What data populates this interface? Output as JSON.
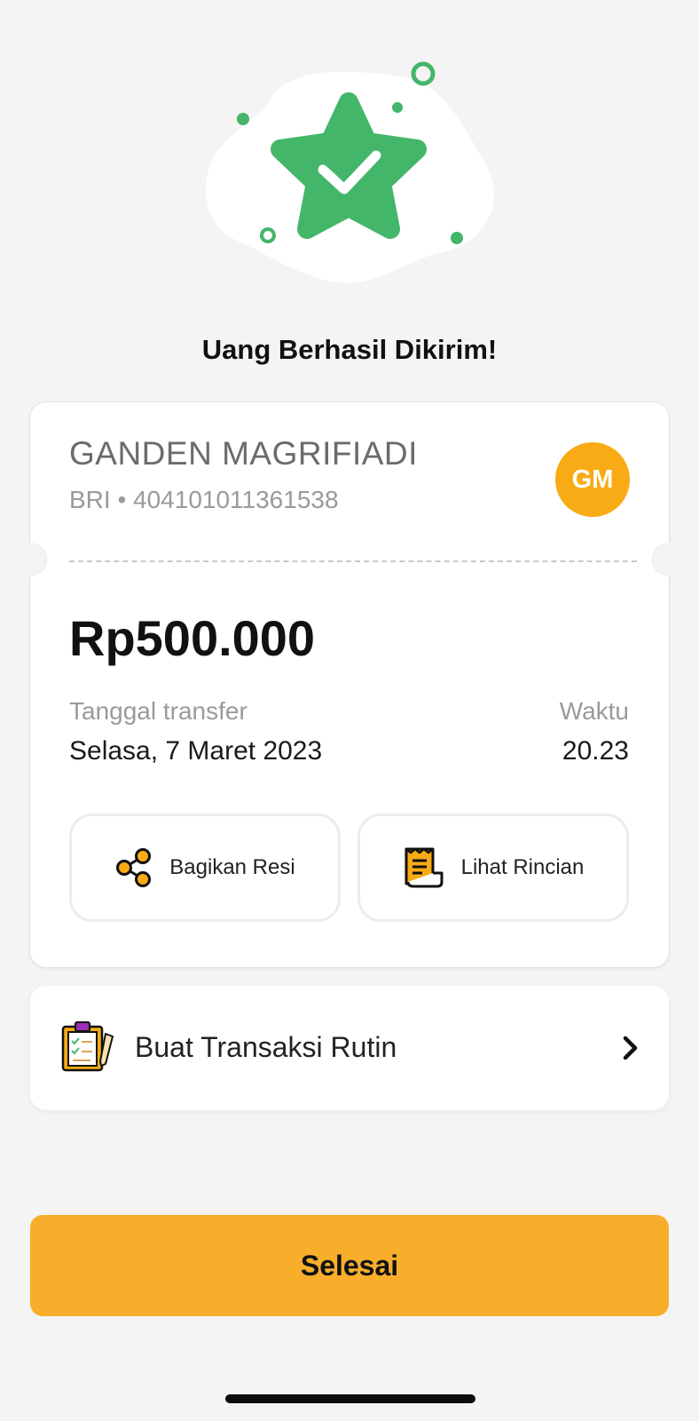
{
  "title": "Uang Berhasil Dikirim!",
  "recipient": {
    "name": "GANDEN MAGRIFIADI",
    "account": "BRI • 404101011361538",
    "initials": "GM"
  },
  "transfer": {
    "amount": "Rp500.000",
    "date_label": "Tanggal transfer",
    "date_value": "Selasa, 7 Maret 2023",
    "time_label": "Waktu",
    "time_value": "20.23"
  },
  "actions": {
    "share_label": "Bagikan Resi",
    "share_icon": "share-icon",
    "detail_label": "Lihat Rincian",
    "detail_icon": "receipt-icon"
  },
  "routine": {
    "label": "Buat Transaksi Rutin",
    "icon": "clipboard-icon"
  },
  "done_label": "Selesai",
  "colors": {
    "success_green": "#43b66a",
    "accent_orange": "#f8ab14",
    "button_yellow": "#f8ae2b",
    "background": "#f4f4f4"
  }
}
